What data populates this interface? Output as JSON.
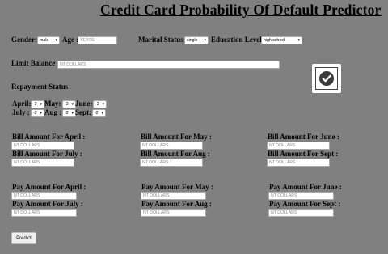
{
  "title": "Credit Card Probability Of Default Predictor",
  "demographics": {
    "gender_label": "Gender:",
    "gender_value": "male",
    "age_label": "Age :",
    "age_placeholder": "YEARS",
    "marital_label": "Marital Status:",
    "marital_value": "single",
    "education_label": "Education Level:",
    "education_value": "high school"
  },
  "limit": {
    "label": "Limit Balance :",
    "placeholder": "NT DOLLARS"
  },
  "checkbox_icon": "check-circle-icon",
  "repayment": {
    "heading": "Repayment Status",
    "april_label": "April:",
    "april_value": "-2",
    "may_label": "May:",
    "may_value": "-2",
    "june_label": "June:",
    "june_value": "-2",
    "july_label": "July :",
    "july_value": "-2",
    "aug_label": "Aug :",
    "aug_value": "-2",
    "sept_label": "Sept:",
    "sept_value": "-2"
  },
  "bill": {
    "april_label": "Bill Amount For April :",
    "may_label": "Bill Amount For May :",
    "june_label": "Bill Amount For June :",
    "july_label": "Bill Amount For July :",
    "aug_label": "Bill Amount For Aug :",
    "sept_label": "Bill Amount For Sept :",
    "placeholder": "NT DOLLARS"
  },
  "pay": {
    "april_label": "Pay Amount For April :",
    "may_label": "Pay Amount For May :",
    "june_label": "Pay Amount For June :",
    "july_label": "Pay Amount For July :",
    "aug_label": "Pay Amount For Aug :",
    "sept_label": "Pay Amount For Sept :",
    "placeholder": "NT DOLLARS"
  },
  "predict_button": "Predict",
  "colors": {
    "background": "#808080",
    "input_bg": "#ffffff"
  }
}
